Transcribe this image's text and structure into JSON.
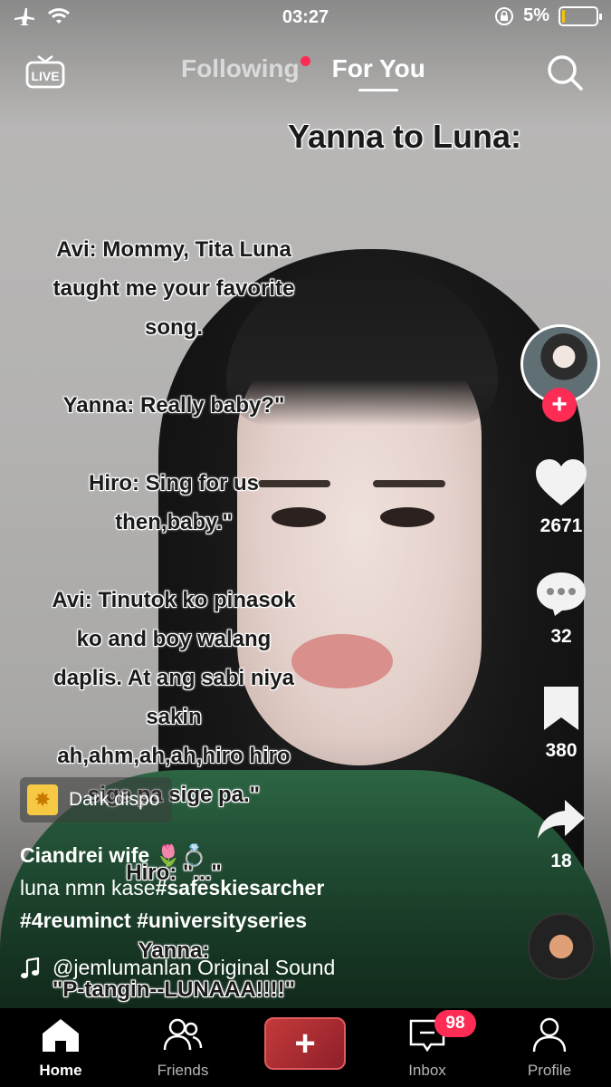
{
  "status_bar": {
    "time": "03:27",
    "battery": "5%"
  },
  "top_nav": {
    "live_label": "LIVE",
    "tabs": [
      {
        "label": "Following"
      },
      {
        "label": "For You"
      }
    ]
  },
  "video": {
    "overlay_title": "Yanna to Luna:",
    "overlay_lines": [
      "Avi: Mommy, Tita Luna",
      "taught me your favorite",
      "song.",
      "",
      "Yanna: Really baby?\"",
      "",
      "Hiro: Sing for us",
      "then,baby.\"",
      "",
      "Avi: Tinutok ko pinasok",
      "ko and boy walang",
      "daplis. At ang sabi niya",
      "sakin",
      "ah,ahm,ah,ah,hiro hiro",
      "sige pa sige pa.\"",
      "",
      "Hiro: \"...\"",
      "",
      "Yanna:",
      "\"P-tangin--LUNAAA!!!!\""
    ]
  },
  "actions": {
    "likes": "2671",
    "comments": "32",
    "saves": "380",
    "shares": "18"
  },
  "effect_label": "Dark dispo",
  "caption": {
    "username": "Ciandrei wife 🌷💍",
    "text": "luna nmn kase",
    "hashtags": [
      "#safeskiesarcher",
      "#4reuminct",
      "#universityseries"
    ]
  },
  "sound": "@jemlumanlan Original Sound",
  "bottom_nav": {
    "items": [
      {
        "label": "Home"
      },
      {
        "label": "Friends"
      },
      {
        "label": "Inbox"
      },
      {
        "label": "Profile"
      }
    ],
    "inbox_badge": "98"
  },
  "colors": {
    "accent": "#fe2c55",
    "battery": "#f5c400"
  }
}
